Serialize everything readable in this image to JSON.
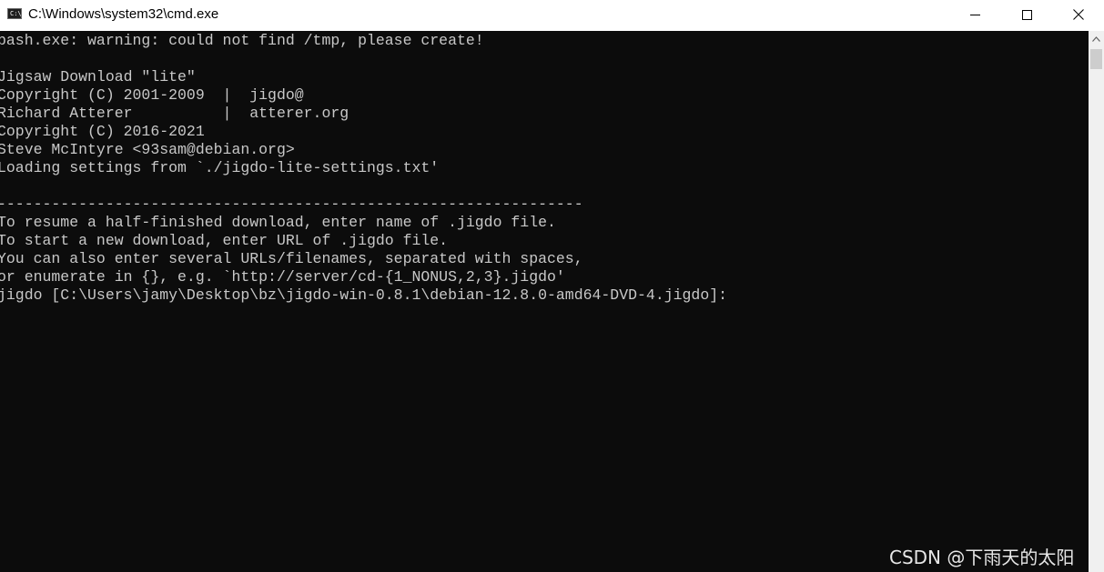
{
  "window": {
    "title": "C:\\Windows\\system32\\cmd.exe",
    "icon": "cmd-console-icon",
    "icon_glyph": "C:\\"
  },
  "controls": {
    "minimize_icon": "minimize-icon",
    "maximize_icon": "maximize-icon",
    "close_icon": "close-icon"
  },
  "console": {
    "background": "#0c0c0c",
    "foreground": "#c8c8c8",
    "lines": [
      "bash.exe: warning: could not find /tmp, please create!",
      "",
      "Jigsaw Download \"lite\"",
      "Copyright (C) 2001-2009  |  jigdo@",
      "Richard Atterer          |  atterer.org",
      "Copyright (C) 2016-2021",
      "Steve McIntyre <93sam@debian.org>",
      "Loading settings from `./jigdo-lite-settings.txt'",
      "",
      "-----------------------------------------------------------------",
      "To resume a half-finished download, enter name of .jigdo file.",
      "To start a new download, enter URL of .jigdo file.",
      "You can also enter several URLs/filenames, separated with spaces,",
      "or enumerate in {}, e.g. `http://server/cd-{1_NONUS,2,3}.jigdo'",
      "jigdo [C:\\Users\\jamy\\Desktop\\bz\\jigdo-win-0.8.1\\debian-12.8.0-amd64-DVD-4.jigdo]:"
    ]
  },
  "watermark": "CSDN @下雨天的太阳",
  "scrollbar": {
    "up_icon": "scroll-up-arrow-icon"
  }
}
